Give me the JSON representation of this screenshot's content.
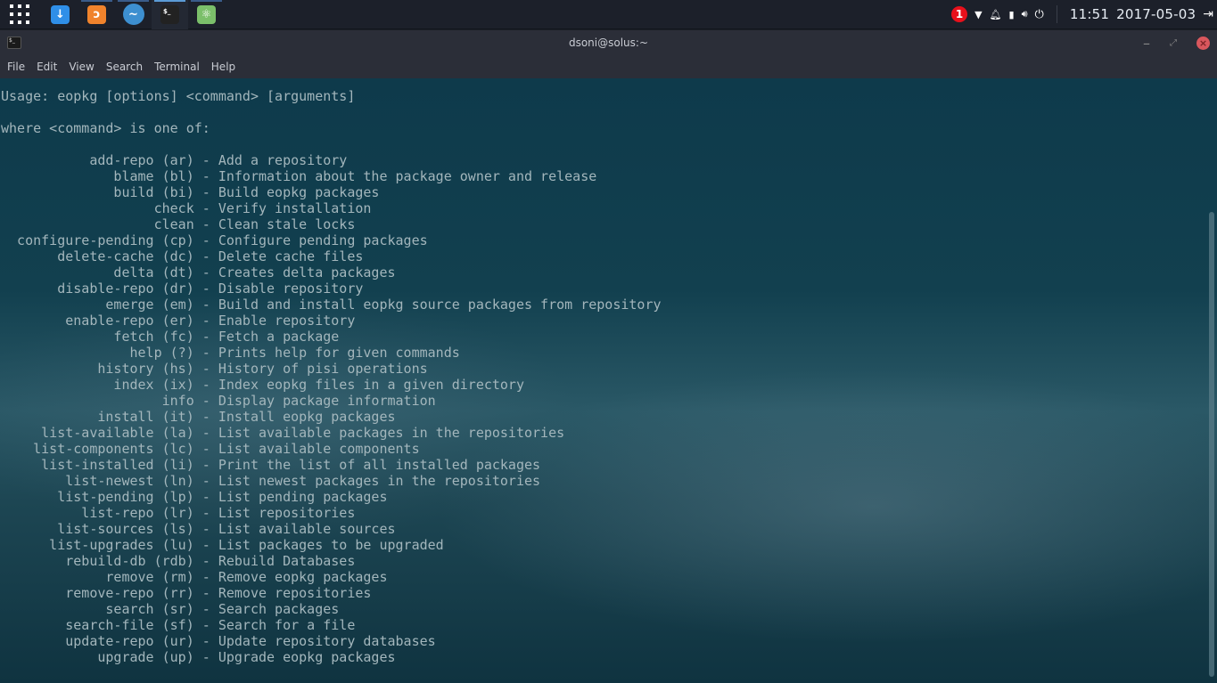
{
  "panel": {
    "tasks": [
      {
        "name": "downloader"
      },
      {
        "name": "firefox"
      },
      {
        "name": "transmission"
      },
      {
        "name": "terminal",
        "label": "$_"
      },
      {
        "name": "atom"
      }
    ],
    "notifications": "1",
    "time": "11:51",
    "date": "2017-05-03"
  },
  "window": {
    "title": "dsoni@solus:~"
  },
  "menu": [
    "File",
    "Edit",
    "View",
    "Search",
    "Terminal",
    "Help"
  ],
  "terminal": {
    "usage": "Usage: eopkg [options] <command> [arguments]",
    "where": "where <command> is one of:",
    "commands": [
      {
        "cmd": "add-repo (ar)",
        "desc": "Add a repository"
      },
      {
        "cmd": "blame (bl)",
        "desc": "Information about the package owner and release"
      },
      {
        "cmd": "build (bi)",
        "desc": "Build eopkg packages"
      },
      {
        "cmd": "check",
        "desc": "Verify installation"
      },
      {
        "cmd": "clean",
        "desc": "Clean stale locks"
      },
      {
        "cmd": "configure-pending (cp)",
        "desc": "Configure pending packages"
      },
      {
        "cmd": "delete-cache (dc)",
        "desc": "Delete cache files"
      },
      {
        "cmd": "delta (dt)",
        "desc": "Creates delta packages"
      },
      {
        "cmd": "disable-repo (dr)",
        "desc": "Disable repository"
      },
      {
        "cmd": "emerge (em)",
        "desc": "Build and install eopkg source packages from repository"
      },
      {
        "cmd": "enable-repo (er)",
        "desc": "Enable repository"
      },
      {
        "cmd": "fetch (fc)",
        "desc": "Fetch a package"
      },
      {
        "cmd": "help (?)",
        "desc": "Prints help for given commands"
      },
      {
        "cmd": "history (hs)",
        "desc": "History of pisi operations"
      },
      {
        "cmd": "index (ix)",
        "desc": "Index eopkg files in a given directory"
      },
      {
        "cmd": "info",
        "desc": "Display package information"
      },
      {
        "cmd": "install (it)",
        "desc": "Install eopkg packages"
      },
      {
        "cmd": "list-available (la)",
        "desc": "List available packages in the repositories"
      },
      {
        "cmd": "list-components (lc)",
        "desc": "List available components"
      },
      {
        "cmd": "list-installed (li)",
        "desc": "Print the list of all installed packages"
      },
      {
        "cmd": "list-newest (ln)",
        "desc": "List newest packages in the repositories"
      },
      {
        "cmd": "list-pending (lp)",
        "desc": "List pending packages"
      },
      {
        "cmd": "list-repo (lr)",
        "desc": "List repositories"
      },
      {
        "cmd": "list-sources (ls)",
        "desc": "List available sources"
      },
      {
        "cmd": "list-upgrades (lu)",
        "desc": "List packages to be upgraded"
      },
      {
        "cmd": "rebuild-db (rdb)",
        "desc": "Rebuild Databases"
      },
      {
        "cmd": "remove (rm)",
        "desc": "Remove eopkg packages"
      },
      {
        "cmd": "remove-repo (rr)",
        "desc": "Remove repositories"
      },
      {
        "cmd": "search (sr)",
        "desc": "Search packages"
      },
      {
        "cmd": "search-file (sf)",
        "desc": "Search for a file"
      },
      {
        "cmd": "update-repo (ur)",
        "desc": "Update repository databases"
      },
      {
        "cmd": "upgrade (up)",
        "desc": "Upgrade eopkg packages"
      }
    ]
  }
}
